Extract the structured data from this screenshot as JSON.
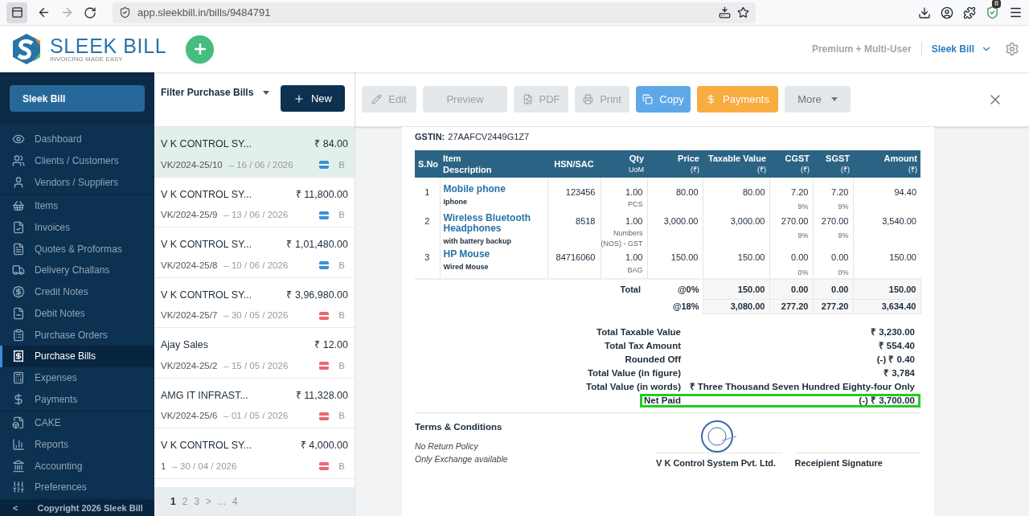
{
  "browser": {
    "url": "app.sleekbill.in/bills/9484791",
    "badge": "8"
  },
  "header": {
    "logo_title": "SLEEK BILL",
    "logo_tagline": "INVOICING MADE EASY",
    "plan": "Premium + Multi-User",
    "account": "Sleek Bill"
  },
  "sidebar": {
    "company": "Sleek Bill",
    "groups": [
      [
        {
          "label": "Dashboard",
          "selected": false
        },
        {
          "label": "Clients / Customers",
          "selected": false
        },
        {
          "label": "Vendors / Suppliers",
          "selected": false
        }
      ],
      [
        {
          "label": "Items",
          "selected": false
        },
        {
          "label": "Invoices",
          "selected": false
        },
        {
          "label": "Quotes & Proformas",
          "selected": false
        },
        {
          "label": "Delivery Challans",
          "selected": false
        },
        {
          "label": "Credit Notes",
          "selected": false
        },
        {
          "label": "Debit Notes",
          "selected": false
        },
        {
          "label": "Purchase Orders",
          "selected": false
        },
        {
          "label": "Purchase Bills",
          "selected": true
        },
        {
          "label": "Expenses",
          "selected": false
        },
        {
          "label": "Payments",
          "selected": false
        }
      ],
      [
        {
          "label": "CAKE",
          "selected": false
        },
        {
          "label": "Reports",
          "selected": false
        },
        {
          "label": "Accounting",
          "selected": false
        },
        {
          "label": "Preferences",
          "selected": false
        }
      ]
    ],
    "collapse": "<",
    "footer": "Copyright 2026 Sleek Bill"
  },
  "list": {
    "filter": "Filter Purchase Bills",
    "new_label": "New",
    "bills": [
      {
        "name": "V K CONTROL SY...",
        "amount": "₹ 84.00",
        "number": "VK/2024-25/10",
        "date": "– 16 / 06 / 2026",
        "color": "#3b8fd9",
        "badge": "B",
        "selected": true
      },
      {
        "name": "V K CONTROL SY...",
        "amount": "₹ 11,800.00",
        "number": "VK/2024-25/9",
        "date": "– 13 / 06 / 2026",
        "color": "#3b8fd9",
        "badge": "B",
        "selected": false
      },
      {
        "name": "V K CONTROL SY...",
        "amount": "₹ 1,01,480.00",
        "number": "VK/2024-25/8",
        "date": "– 10 / 06 / 2026",
        "color": "#3b8fd9",
        "badge": "B",
        "selected": false
      },
      {
        "name": "V K CONTROL SY...",
        "amount": "₹ 3,96,980.00",
        "number": "VK/2024-25/7",
        "date": "– 30 / 05 / 2026",
        "color": "#f0646e",
        "badge": "B",
        "selected": false
      },
      {
        "name": "Ajay Sales",
        "amount": "₹ 12.00",
        "number": "VK/2024-25/2",
        "date": "– 15 / 05 / 2026",
        "color": "#f0646e",
        "badge": "B",
        "selected": false
      },
      {
        "name": "AMG IT INFRAST...",
        "amount": "₹ 11,328.00",
        "number": "VK/2024-25/6",
        "date": "– 01 / 05 / 2026",
        "color": "#f0646e",
        "badge": "B",
        "selected": false
      },
      {
        "name": "V K CONTROL SY...",
        "amount": "₹ 4,000.00",
        "number": "1",
        "date": "– 30 / 04 / 2026",
        "color": "#f0646e",
        "badge": "B",
        "selected": false
      }
    ],
    "pages": [
      {
        "label": "1",
        "selected": true
      },
      {
        "label": "2",
        "selected": false
      },
      {
        "label": "3",
        "selected": false
      }
    ],
    "next": ">",
    "ellipsis": "...",
    "last_page": "4"
  },
  "toolbar": [
    {
      "label": "Edit",
      "kind": "edit",
      "disabled": true
    },
    {
      "label": "Preview",
      "kind": "preview",
      "disabled": true
    },
    {
      "label": "PDF",
      "kind": "pdf",
      "disabled": true
    },
    {
      "label": "Print",
      "kind": "print",
      "disabled": true
    },
    {
      "label": "Copy",
      "kind": "copy",
      "disabled": false
    },
    {
      "label": "Payments",
      "kind": "payments",
      "disabled": false
    },
    {
      "label": "More",
      "kind": "more",
      "disabled": false
    }
  ],
  "document": {
    "gstin_label": "GSTIN:",
    "gstin": "27AAFCV2449G1Z7",
    "columns": [
      {
        "label": "S.No"
      },
      {
        "label": "Item",
        "sub": "Description"
      },
      {
        "label": "HSN/SAC"
      },
      {
        "label": "Qty",
        "sub": "UoM"
      },
      {
        "label": "Price",
        "sub": "(₹)"
      },
      {
        "label": "Taxable Value",
        "sub": "(₹)"
      },
      {
        "label": "CGST",
        "sub": "(₹)"
      },
      {
        "label": "SGST",
        "sub": "(₹)"
      },
      {
        "label": "Amount",
        "sub": "(₹)"
      }
    ],
    "rows": [
      {
        "sno": "1",
        "name": "Mobile phone",
        "desc": "Iphone",
        "hsn": "123456",
        "qty": "1.00",
        "uom": "PCS",
        "price": "80.00",
        "taxable": "80.00",
        "cgst": "7.20",
        "cgst_rate": "9%",
        "sgst": "7.20",
        "sgst_rate": "9%",
        "amount": "94.40"
      },
      {
        "sno": "2",
        "name": "Wireless Bluetooth Headphones",
        "desc": "with battery backup",
        "hsn": "8518",
        "qty": "1.00",
        "uom": "Numbers (NOS) - GST",
        "price": "3,000.00",
        "taxable": "3,000.00",
        "cgst": "270.00",
        "cgst_rate": "9%",
        "sgst": "270.00",
        "sgst_rate": "9%",
        "amount": "3,540.00"
      },
      {
        "sno": "3",
        "name": "HP Mouse",
        "desc": "Wired Mouse",
        "hsn": "84716060",
        "qty": "1.00",
        "uom": "BAG",
        "price": "150.00",
        "taxable": "150.00",
        "cgst": "0.00",
        "cgst_rate": "0%",
        "sgst": "0.00",
        "sgst_rate": "0%",
        "amount": "150.00"
      }
    ],
    "total_label": "Total",
    "totals": [
      {
        "rate": "@0%",
        "taxable": "150.00",
        "cgst": "0.00",
        "sgst": "0.00",
        "amount": "150.00"
      },
      {
        "rate": "@18%",
        "taxable": "3,080.00",
        "cgst": "277.20",
        "sgst": "277.20",
        "amount": "3,634.40"
      }
    ],
    "summary": [
      {
        "label": "Total Taxable Value",
        "value": "₹ 3,230.00",
        "highlighted": false
      },
      {
        "label": "Total Tax Amount",
        "value": "₹ 554.40",
        "highlighted": false
      },
      {
        "label": "Rounded Off",
        "value": "(-) ₹ 0.40",
        "highlighted": false
      },
      {
        "label": "Total Value (in figure)",
        "value": "₹ 3,784",
        "highlighted": false
      },
      {
        "label": "Total Value (in words)",
        "value": "₹ Three Thousand Seven Hundred Eighty-four Only",
        "highlighted": false
      },
      {
        "label": "Net Paid",
        "value": "(-) ₹ 3,700.00",
        "highlighted": true
      }
    ],
    "terms_title": "Terms & Conditions",
    "terms": [
      "No Return Policy",
      "Only Exchange available"
    ],
    "signatures": [
      "V K Control System Pvt. Ltd.",
      "Receipient Signature"
    ]
  }
}
